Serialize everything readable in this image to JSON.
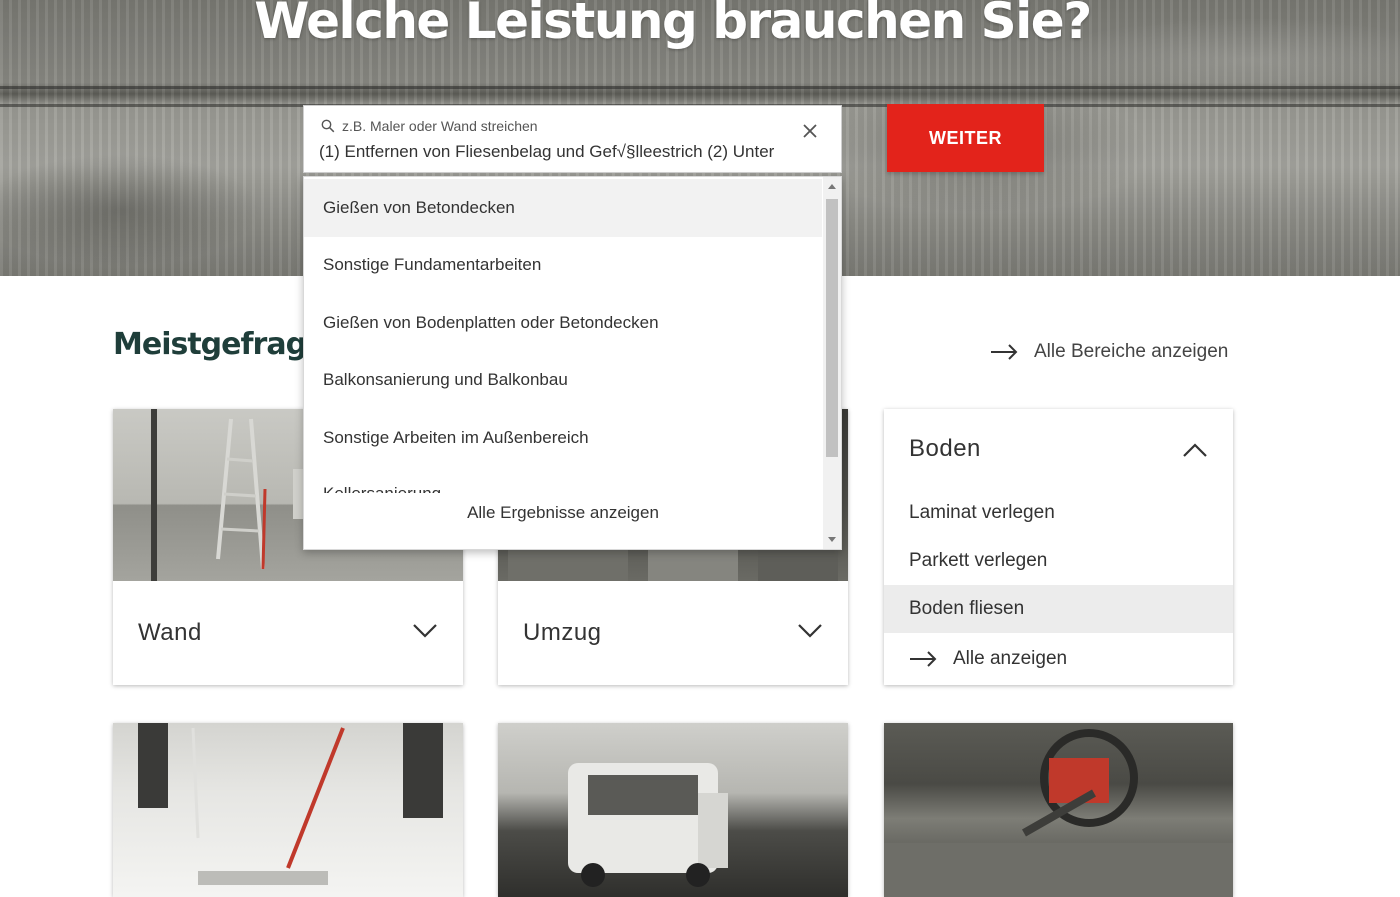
{
  "hero": {
    "title": "Welche Leistung brauchen Sie?"
  },
  "search": {
    "placeholder": "z.B. Maler oder Wand streichen",
    "value": "(1) Entfernen von Fliesenbelag und Gef√§lleestrich  (2) Unter",
    "button_label": "WEITER"
  },
  "dropdown": {
    "items": [
      {
        "label": "Gießen von Betondecken"
      },
      {
        "label": "Sonstige Fundamentarbeiten"
      },
      {
        "label": "Gießen von Bodenplatten oder Betondecken"
      },
      {
        "label": "Balkonsanierung und Balkonbau"
      },
      {
        "label": "Sonstige Arbeiten im Außenbereich"
      },
      {
        "label": "Kellersanierung"
      }
    ],
    "footer_label": "Alle Ergebnisse anzeigen"
  },
  "section": {
    "title": "Meistgefragte l",
    "all_link": "Alle Bereiche anzeigen"
  },
  "cards": [
    {
      "label": "Wand"
    },
    {
      "label": "Umzug"
    }
  ],
  "boden": {
    "title": "Boden",
    "items": [
      {
        "label": "Laminat verlegen"
      },
      {
        "label": "Parkett verlegen"
      },
      {
        "label": "Boden fliesen"
      }
    ],
    "all_label": "Alle anzeigen"
  },
  "colors": {
    "accent": "#e3231b",
    "heading": "#1f3e3a"
  }
}
